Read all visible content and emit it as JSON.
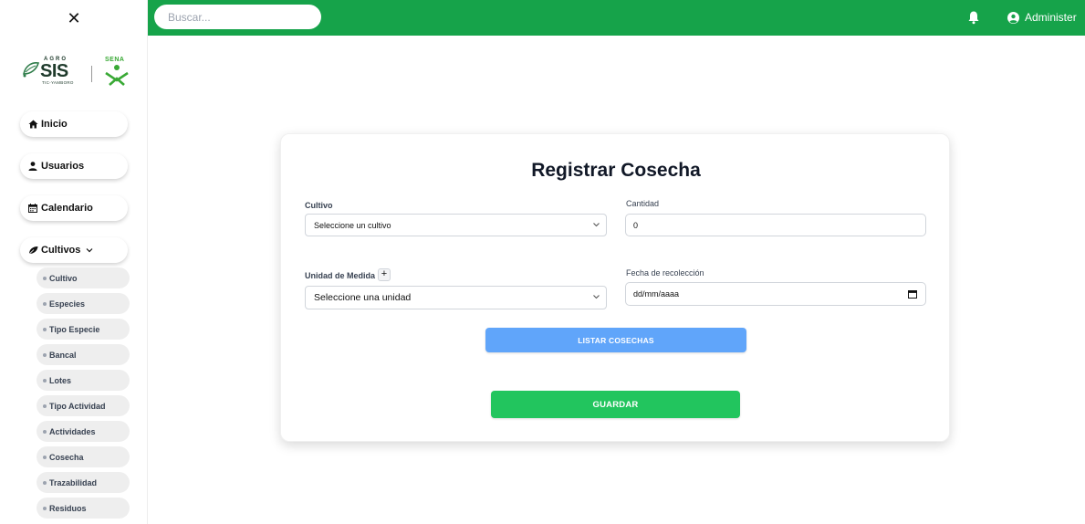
{
  "header": {
    "search_placeholder": "Buscar...",
    "user_name": "Administer"
  },
  "sidebar": {
    "close_glyph": "✕",
    "logo": {
      "agro": "AGRO",
      "sis": "SIS",
      "sub": "TIC-YAMBORO",
      "sena": "SENA"
    },
    "nav": [
      {
        "label": "Inicio",
        "icon": "home-icon"
      },
      {
        "label": "Usuarios",
        "icon": "user-icon"
      },
      {
        "label": "Calendario",
        "icon": "calendar-icon"
      },
      {
        "label": "Cultivos",
        "icon": "leaf-icon",
        "expanded": true
      }
    ],
    "sub_items": [
      "Cultivo",
      "Especies",
      "Tipo Especie",
      "Bancal",
      "Lotes",
      "Tipo Actividad",
      "Actividades",
      "Cosecha",
      "Trazabilidad",
      "Residuos"
    ]
  },
  "form": {
    "title": "Registrar Cosecha",
    "cultivo_label": "Cultivo",
    "cultivo_value": "Seleccione un cultivo",
    "cantidad_label": "Cantidad",
    "cantidad_value": "0",
    "unidad_label": "Unidad de Medida",
    "unidad_add": "+",
    "unidad_value": "Seleccione una unidad",
    "fecha_label": "Fecha de recolección",
    "fecha_value": "dd/mm/aaaa",
    "list_button": "LISTAR COSECHAS",
    "save_button": "GUARDAR"
  },
  "colors": {
    "header": "#16a34a",
    "list_button": "#60a5fa",
    "save_button": "#22c55e"
  }
}
